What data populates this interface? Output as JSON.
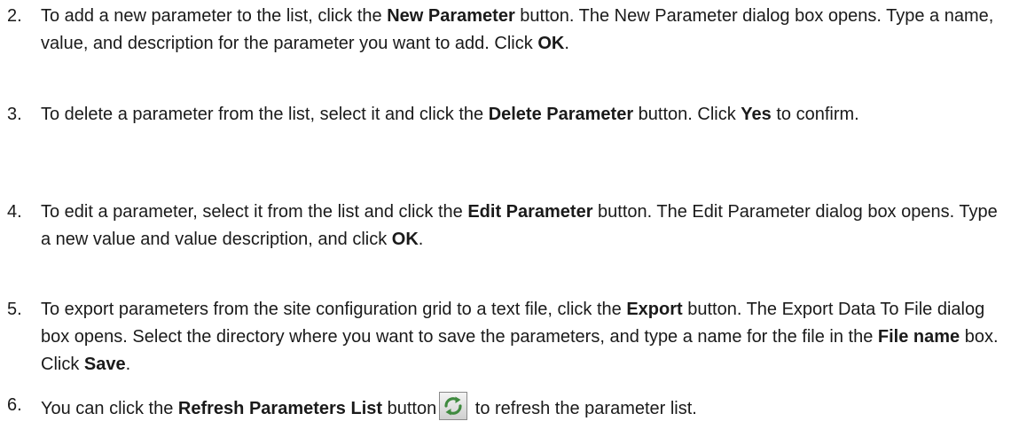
{
  "steps": [
    {
      "number": "2.",
      "t1": "To add a new parameter to the list, click the ",
      "b1": "New Parameter",
      "t2": " button. The New Parameter dialog box opens. Type a name, value, and description for the parameter you want to add. Click ",
      "b2": "OK",
      "t3": "."
    },
    {
      "number": "3.",
      "t1": "To delete a parameter from the list, select it and click the ",
      "b1": "Delete Parameter",
      "t2": " button. Click ",
      "b2": "Yes",
      "t3": " to confirm."
    },
    {
      "number": "4.",
      "t1": "To edit a parameter, select it from the list and click the ",
      "b1": "Edit Parameter",
      "t2": " button. The Edit Parameter dialog box opens. Type a new value and value description, and click ",
      "b2": "OK",
      "t3": "."
    },
    {
      "number": "5.",
      "t1": "To export parameters from the site configuration grid to a text file, click the ",
      "b1": "Export",
      "t2": " button. The Export Data To File dialog box opens. Select the directory where you want to save the parameters, and type a name for the file in the ",
      "b2": "File name",
      "t3": " box. Click ",
      "b3": "Save",
      "t4": "."
    },
    {
      "number": "6.",
      "t1": "You can click the ",
      "b1": "Refresh Parameters List",
      "t2": " button",
      "t3": " to refresh the parameter list.",
      "icon": "refresh-icon"
    }
  ]
}
